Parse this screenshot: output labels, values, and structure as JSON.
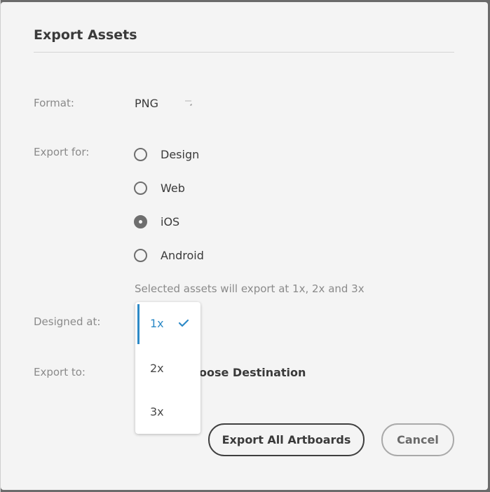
{
  "dialog": {
    "title": "Export Assets"
  },
  "format": {
    "label": "Format:",
    "value": "PNG"
  },
  "export_for": {
    "label": "Export for:",
    "options": [
      {
        "label": "Design",
        "selected": false
      },
      {
        "label": "Web",
        "selected": false
      },
      {
        "label": "iOS",
        "selected": true
      },
      {
        "label": "Android",
        "selected": false
      }
    ],
    "hint": "Selected assets will export at 1x, 2x and 3x"
  },
  "designed_at": {
    "label": "Designed at:",
    "options": [
      "1x",
      "2x",
      "3x"
    ],
    "selected": "1x"
  },
  "export_to": {
    "label": "Export to:",
    "destination": "oose Destination"
  },
  "buttons": {
    "export_all": "Export All Artboards",
    "cancel": "Cancel"
  },
  "colors": {
    "accent": "#2d8ac7",
    "text": "#3a3a3a",
    "muted": "#8a8a8a",
    "background": "#f4f4f4"
  }
}
